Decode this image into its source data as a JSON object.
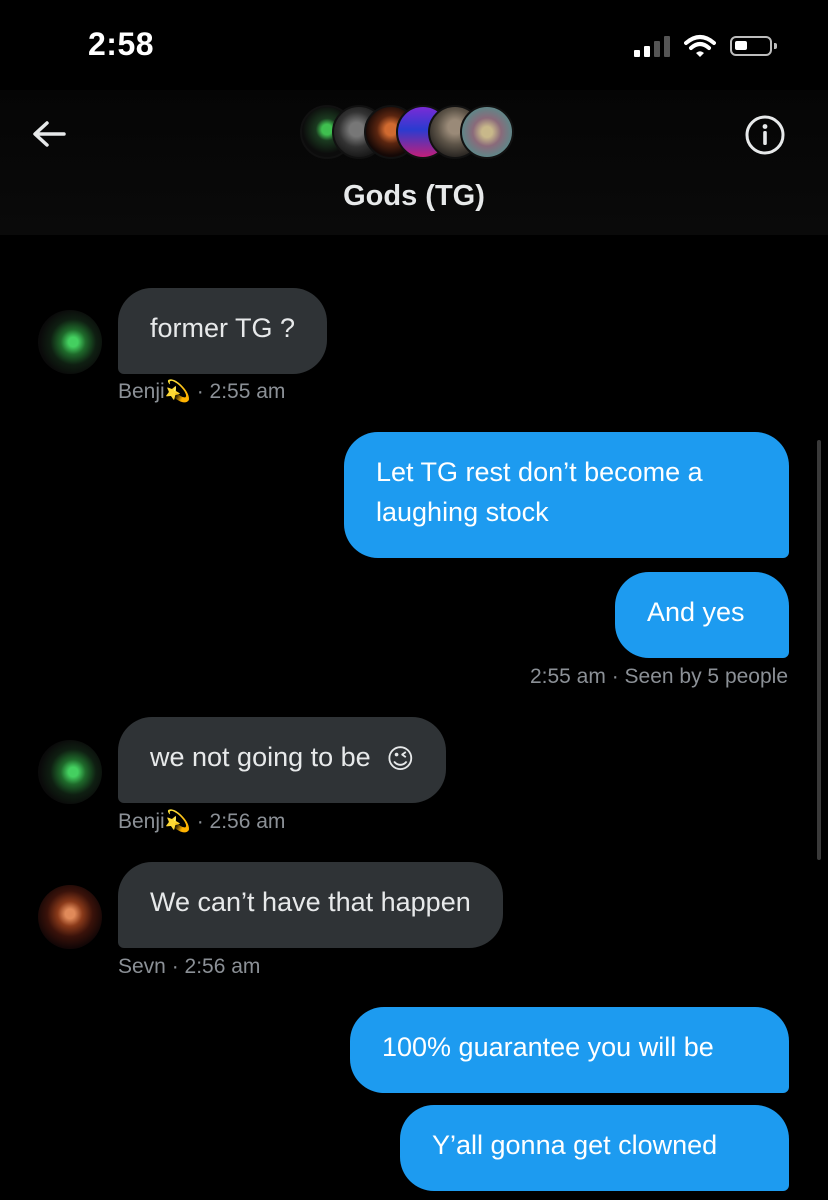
{
  "status_bar": {
    "time": "2:58"
  },
  "header": {
    "title": "Gods (TG)"
  },
  "messages": [
    {
      "sender": "Benji💫",
      "text": "former TG ?",
      "time": "2:55 am"
    },
    {
      "text": "Let TG rest don’t become a laughing stock"
    },
    {
      "text": "And yes",
      "time": "2:55 am",
      "seen": "Seen by 5 people"
    },
    {
      "sender": "Benji💫",
      "text": "we not going to be",
      "emoji": "😉",
      "time": "2:56 am"
    },
    {
      "sender": "Sevn",
      "text": "We can’t have that happen",
      "time": "2:56 am"
    },
    {
      "text": "100% guarantee you will be"
    },
    {
      "text": "Y’all gonna get clowned"
    }
  ],
  "colors": {
    "accent": "#1d9bf0",
    "incoming_bubble": "#2f3336",
    "meta_text": "#8b9096"
  }
}
